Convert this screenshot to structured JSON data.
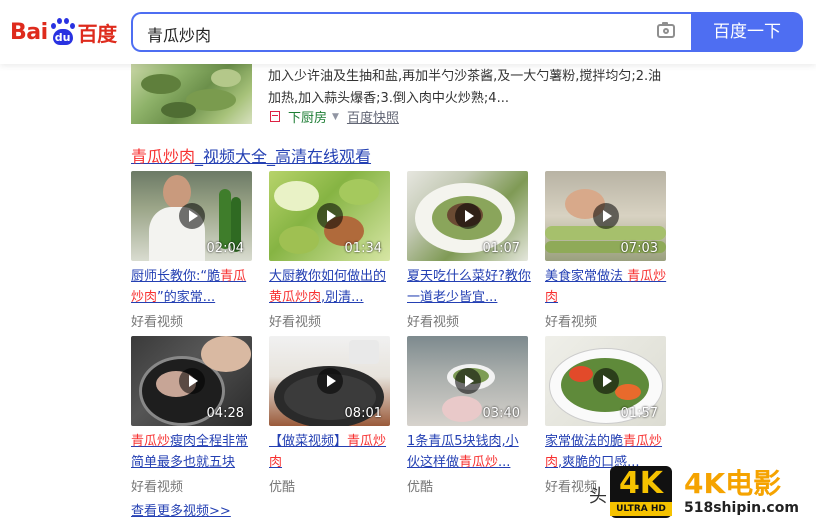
{
  "header": {
    "logo": {
      "part1": "Bai",
      "paw_text": "du",
      "part2": "百度"
    },
    "search": {
      "query": "青瓜炒肉"
    },
    "search_button_label": "百度一下"
  },
  "snippet": {
    "text": "加入少许油及生抽和盐,再加半勺沙茶酱,及一大勺薯粉,搅拌均匀;2.油加热,加入蒜头爆香;3.倒入肉中火炒熟;4...",
    "source": "下厨房",
    "snapshot": "百度快照"
  },
  "video_block": {
    "title_hl": "青瓜炒肉",
    "title_rest": "_视频大全_高清在线观看",
    "more_label": "查看更多视频>>",
    "videos": [
      {
        "title_pre": "厨师长教你:“脆",
        "title_hl": "青瓜炒肉",
        "title_post": "”的家常...",
        "duration": "02:04",
        "source": "好看视频"
      },
      {
        "title_pre": "大厨教你如何做出的",
        "title_hl": "黄瓜炒肉",
        "title_post": ",別清...",
        "duration": "01:34",
        "source": "好看视频"
      },
      {
        "title_pre": "夏天吃什么菜好?教你一道老少皆宜...",
        "title_hl": "",
        "title_post": "",
        "duration": "01:07",
        "source": "好看视频"
      },
      {
        "title_pre": "美食家常做法 ",
        "title_hl": "青瓜炒肉",
        "title_post": "",
        "duration": "07:03",
        "source": "好看视频"
      },
      {
        "title_pre": "",
        "title_hl": "青瓜炒",
        "title_post": "瘦肉全程非常简单最多也就五块",
        "duration": "04:28",
        "source": "好看视频"
      },
      {
        "title_pre": "【做菜视频】",
        "title_hl": "青瓜炒肉",
        "title_post": "",
        "duration": "08:01",
        "source": "优酷"
      },
      {
        "title_pre": "1条青瓜5块钱肉,小伙这样做",
        "title_hl": "青瓜炒",
        "title_post": "...",
        "duration": "03:40",
        "source": "优酷"
      },
      {
        "title_pre": "家常做法的脆",
        "title_hl": "青瓜炒肉",
        "title_post": ",爽脆的口感...",
        "duration": "01:57",
        "source": "好看视频"
      }
    ]
  },
  "watermark": {
    "head": "头",
    "badge": "4K",
    "badge_sub": "ULTRA HD",
    "brand": "4K电影",
    "site": "518shipin.com"
  },
  "colors": {
    "brand_blue": "#4e6ef2",
    "link_blue": "#2440b3",
    "highlight_red": "#f73131",
    "logo_red": "#de2b1d",
    "source_green": "#1e7e35"
  }
}
